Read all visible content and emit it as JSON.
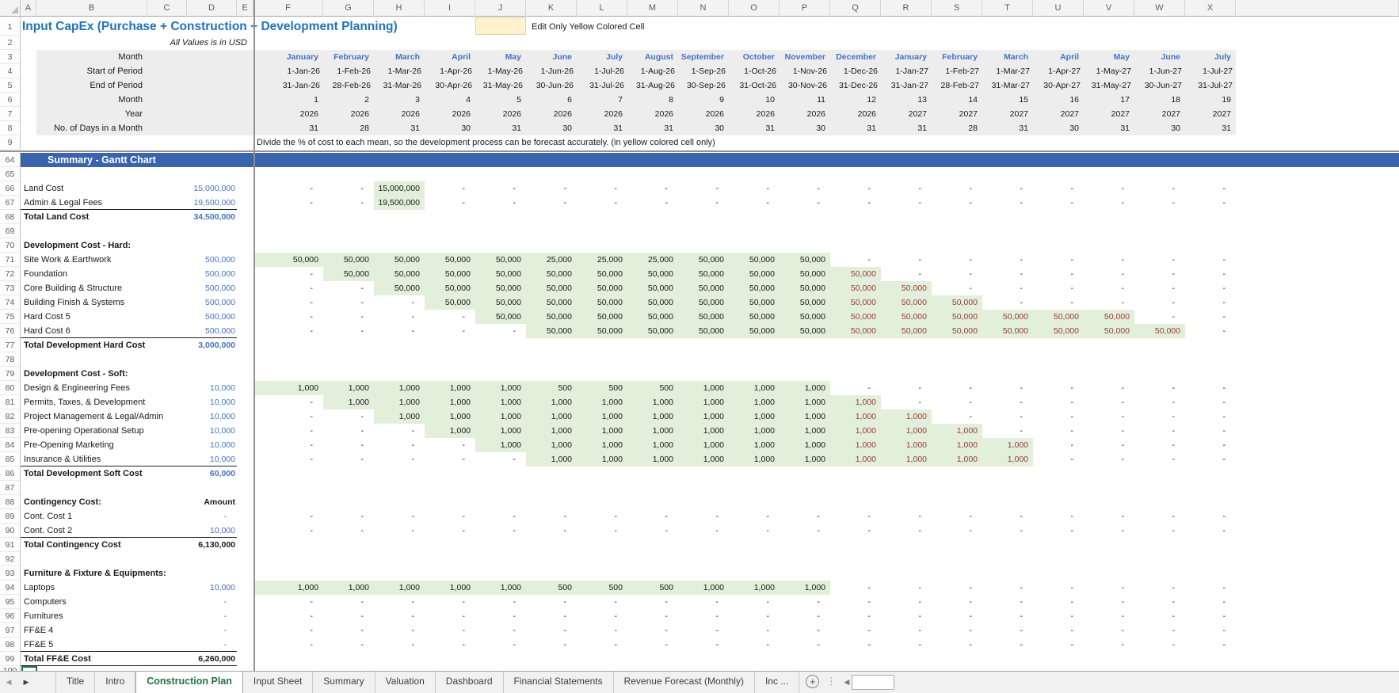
{
  "sheet": {
    "title": "Input CapEx (Purchase + Construction + Development Planning)",
    "subtitle": "All Values is in USD",
    "edit_note": "Edit Only Yellow Colored Cell",
    "hint": "Divide the % of cost to each mean, so the development process can be forecast accurately. (in yellow colored cell only)"
  },
  "colors": {
    "title_blue": "#2173BC",
    "value_blue": "#4472C4",
    "negative_red": "#9C3A38",
    "gantt_green_fill": "#E2EFDA",
    "band_blue": "#3A63AE",
    "active_tab_green": "#217346",
    "header_fill": "#EDEDED",
    "yellow_cell": "#FFF2CC"
  },
  "columns": {
    "letters": [
      "A",
      "B",
      "C",
      "D",
      "E",
      "F",
      "G",
      "H",
      "I",
      "J",
      "K",
      "L",
      "M",
      "N",
      "O",
      "P",
      "Q",
      "R",
      "S",
      "T",
      "U",
      "V",
      "W",
      "X"
    ]
  },
  "row_numbers_top": [
    "1",
    "2",
    "3",
    "4",
    "5",
    "6",
    "7",
    "8",
    "9"
  ],
  "frozen_labels": [
    "Month",
    "Start of Period",
    "End of Period",
    "Month",
    "Year",
    "No. of Days in a Month"
  ],
  "months": {
    "names": [
      "January",
      "February",
      "March",
      "April",
      "May",
      "June",
      "July",
      "August",
      "September",
      "October",
      "November",
      "December",
      "January",
      "February",
      "March",
      "April",
      "May",
      "June",
      "July"
    ],
    "start": [
      "1-Jan-26",
      "1-Feb-26",
      "1-Mar-26",
      "1-Apr-26",
      "1-May-26",
      "1-Jun-26",
      "1-Jul-26",
      "1-Aug-26",
      "1-Sep-26",
      "1-Oct-26",
      "1-Nov-26",
      "1-Dec-26",
      "1-Jan-27",
      "1-Feb-27",
      "1-Mar-27",
      "1-Apr-27",
      "1-May-27",
      "1-Jun-27",
      "1-Jul-27"
    ],
    "end": [
      "31-Jan-26",
      "28-Feb-26",
      "31-Mar-26",
      "30-Apr-26",
      "31-May-26",
      "30-Jun-26",
      "31-Jul-26",
      "31-Aug-26",
      "30-Sep-26",
      "31-Oct-26",
      "30-Nov-26",
      "31-Dec-26",
      "31-Jan-27",
      "28-Feb-27",
      "31-Mar-27",
      "30-Apr-27",
      "31-May-27",
      "30-Jun-27",
      "31-Jul-27"
    ],
    "index": [
      "1",
      "2",
      "3",
      "4",
      "5",
      "6",
      "7",
      "8",
      "9",
      "10",
      "11",
      "12",
      "13",
      "14",
      "15",
      "16",
      "17",
      "18",
      "19"
    ],
    "year": [
      "2026",
      "2026",
      "2026",
      "2026",
      "2026",
      "2026",
      "2026",
      "2026",
      "2026",
      "2026",
      "2026",
      "2026",
      "2027",
      "2027",
      "2027",
      "2027",
      "2027",
      "2027",
      "2027"
    ],
    "days": [
      "31",
      "28",
      "31",
      "30",
      "31",
      "30",
      "31",
      "31",
      "30",
      "31",
      "30",
      "31",
      "31",
      "28",
      "31",
      "30",
      "31",
      "30",
      "31"
    ]
  },
  "rows": [
    {
      "n": 64,
      "t": "band",
      "label": "Summary - Gantt Chart"
    },
    {
      "n": 65,
      "t": "empty"
    },
    {
      "n": 66,
      "t": "item",
      "label": "Land Cost",
      "amount": "15,000,000",
      "amt": "blue",
      "green": [
        2,
        2
      ],
      "vals": [
        "-",
        "-",
        "15,000,000",
        "-",
        "-",
        "-",
        "-",
        "-",
        "-",
        "-",
        "-",
        "-",
        "-",
        "-",
        "-",
        "-",
        "-",
        "-",
        "-"
      ]
    },
    {
      "n": 67,
      "t": "item",
      "label": "Admin & Legal Fees",
      "amount": "19,500,000",
      "amt": "blue",
      "ul": true,
      "green": [
        2,
        2
      ],
      "vals": [
        "-",
        "-",
        "19,500,000",
        "-",
        "-",
        "-",
        "-",
        "-",
        "-",
        "-",
        "-",
        "-",
        "-",
        "-",
        "-",
        "-",
        "-",
        "-",
        "-"
      ]
    },
    {
      "n": 68,
      "t": "total",
      "label": "Total Land Cost",
      "amount": "34,500,000",
      "amt": "blue-bold"
    },
    {
      "n": 69,
      "t": "empty"
    },
    {
      "n": 70,
      "t": "section",
      "label": "Development Cost - Hard:"
    },
    {
      "n": 71,
      "t": "item",
      "label": "Site Work & Earthwork",
      "amount": "500,000",
      "amt": "blue",
      "green": [
        0,
        10
      ],
      "vals": [
        "50,000",
        "50,000",
        "50,000",
        "50,000",
        "50,000",
        "25,000",
        "25,000",
        "25,000",
        "50,000",
        "50,000",
        "50,000",
        "-",
        "-",
        "-",
        "-",
        "-",
        "-",
        "-",
        "-"
      ]
    },
    {
      "n": 72,
      "t": "item",
      "label": "Foundation",
      "amount": "500,000",
      "amt": "blue",
      "green": [
        1,
        11
      ],
      "red": [
        11,
        11
      ],
      "vals": [
        "-",
        "50,000",
        "50,000",
        "50,000",
        "50,000",
        "50,000",
        "50,000",
        "50,000",
        "50,000",
        "50,000",
        "50,000",
        "50,000",
        "-",
        "-",
        "-",
        "-",
        "-",
        "-",
        "-"
      ]
    },
    {
      "n": 73,
      "t": "item",
      "label": "Core Building & Structure",
      "amount": "500,000",
      "amt": "blue",
      "green": [
        2,
        12
      ],
      "red": [
        11,
        12
      ],
      "vals": [
        "-",
        "-",
        "50,000",
        "50,000",
        "50,000",
        "50,000",
        "50,000",
        "50,000",
        "50,000",
        "50,000",
        "50,000",
        "50,000",
        "50,000",
        "-",
        "-",
        "-",
        "-",
        "-",
        "-"
      ]
    },
    {
      "n": 74,
      "t": "item",
      "label": "Building Finish & Systems",
      "amount": "500,000",
      "amt": "blue",
      "green": [
        3,
        13
      ],
      "red": [
        11,
        13
      ],
      "vals": [
        "-",
        "-",
        "-",
        "50,000",
        "50,000",
        "50,000",
        "50,000",
        "50,000",
        "50,000",
        "50,000",
        "50,000",
        "50,000",
        "50,000",
        "50,000",
        "-",
        "-",
        "-",
        "-",
        "-"
      ]
    },
    {
      "n": 75,
      "t": "item",
      "label": "Hard Cost 5",
      "amount": "500,000",
      "amt": "blue",
      "green": [
        4,
        16
      ],
      "red": [
        11,
        16
      ],
      "vals": [
        "-",
        "-",
        "-",
        "-",
        "50,000",
        "50,000",
        "50,000",
        "50,000",
        "50,000",
        "50,000",
        "50,000",
        "50,000",
        "50,000",
        "50,000",
        "50,000",
        "50,000",
        "50,000",
        "-",
        "-"
      ]
    },
    {
      "n": 76,
      "t": "item",
      "label": "Hard Cost 6",
      "amount": "500,000",
      "amt": "blue",
      "ul": true,
      "green": [
        5,
        17
      ],
      "red": [
        11,
        17
      ],
      "vals": [
        "-",
        "-",
        "-",
        "-",
        "-",
        "50,000",
        "50,000",
        "50,000",
        "50,000",
        "50,000",
        "50,000",
        "50,000",
        "50,000",
        "50,000",
        "50,000",
        "50,000",
        "50,000",
        "50,000",
        "-"
      ]
    },
    {
      "n": 77,
      "t": "total",
      "label": "Total Development Hard Cost",
      "amount": "3,000,000",
      "amt": "blue-bold"
    },
    {
      "n": 78,
      "t": "empty"
    },
    {
      "n": 79,
      "t": "section",
      "label": "Development Cost - Soft:"
    },
    {
      "n": 80,
      "t": "item",
      "label": "Design & Engineering Fees",
      "amount": "10,000",
      "amt": "blue",
      "green": [
        0,
        10
      ],
      "vals": [
        "1,000",
        "1,000",
        "1,000",
        "1,000",
        "1,000",
        "500",
        "500",
        "500",
        "1,000",
        "1,000",
        "1,000",
        "-",
        "-",
        "-",
        "-",
        "-",
        "-",
        "-",
        "-"
      ]
    },
    {
      "n": 81,
      "t": "item",
      "label": "Permits, Taxes, & Development",
      "amount": "10,000",
      "amt": "blue",
      "green": [
        1,
        11
      ],
      "red": [
        11,
        11
      ],
      "vals": [
        "-",
        "1,000",
        "1,000",
        "1,000",
        "1,000",
        "1,000",
        "1,000",
        "1,000",
        "1,000",
        "1,000",
        "1,000",
        "1,000",
        "-",
        "-",
        "-",
        "-",
        "-",
        "-",
        "-"
      ]
    },
    {
      "n": 82,
      "t": "item",
      "label": "Project Management & Legal/Admin",
      "amount": "10,000",
      "amt": "blue",
      "green": [
        2,
        12
      ],
      "red": [
        11,
        12
      ],
      "vals": [
        "-",
        "-",
        "1,000",
        "1,000",
        "1,000",
        "1,000",
        "1,000",
        "1,000",
        "1,000",
        "1,000",
        "1,000",
        "1,000",
        "1,000",
        "-",
        "-",
        "-",
        "-",
        "-",
        "-"
      ]
    },
    {
      "n": 83,
      "t": "item",
      "label": "Pre-opening Operational Setup",
      "amount": "10,000",
      "amt": "blue",
      "green": [
        3,
        13
      ],
      "red": [
        11,
        13
      ],
      "vals": [
        "-",
        "-",
        "-",
        "1,000",
        "1,000",
        "1,000",
        "1,000",
        "1,000",
        "1,000",
        "1,000",
        "1,000",
        "1,000",
        "1,000",
        "1,000",
        "-",
        "-",
        "-",
        "-",
        "-"
      ]
    },
    {
      "n": 84,
      "t": "item",
      "label": "Pre-Opening Marketing",
      "amount": "10,000",
      "amt": "blue",
      "green": [
        4,
        14
      ],
      "red": [
        11,
        14
      ],
      "vals": [
        "-",
        "-",
        "-",
        "-",
        "1,000",
        "1,000",
        "1,000",
        "1,000",
        "1,000",
        "1,000",
        "1,000",
        "1,000",
        "1,000",
        "1,000",
        "1,000",
        "-",
        "-",
        "-",
        "-"
      ]
    },
    {
      "n": 85,
      "t": "item",
      "label": "Insurance & Utilities",
      "amount": "10,000",
      "amt": "blue",
      "ul": true,
      "green": [
        5,
        14
      ],
      "red": [
        11,
        14
      ],
      "vals": [
        "-",
        "-",
        "-",
        "-",
        "-",
        "1,000",
        "1,000",
        "1,000",
        "1,000",
        "1,000",
        "1,000",
        "1,000",
        "1,000",
        "1,000",
        "1,000",
        "-",
        "-",
        "-",
        "-"
      ]
    },
    {
      "n": 86,
      "t": "total",
      "label": "Total Development Soft Cost",
      "amount": "60,000",
      "amt": "blue-bold"
    },
    {
      "n": 87,
      "t": "empty"
    },
    {
      "n": 88,
      "t": "section",
      "label": "Contingency Cost:",
      "amount": "Amount",
      "amt": "black-bold"
    },
    {
      "n": 89,
      "t": "item",
      "label": "Cont. Cost 1",
      "amount": "-",
      "amt": "blue",
      "vals": [
        "-",
        "-",
        "-",
        "-",
        "-",
        "-",
        "-",
        "-",
        "-",
        "-",
        "-",
        "-",
        "-",
        "-",
        "-",
        "-",
        "-",
        "-",
        "-"
      ]
    },
    {
      "n": 90,
      "t": "item",
      "label": "Cont. Cost 2",
      "amount": "10,000",
      "amt": "blue",
      "ul": true,
      "vals": [
        "-",
        "-",
        "-",
        "-",
        "-",
        "-",
        "-",
        "-",
        "-",
        "-",
        "-",
        "-",
        "-",
        "-",
        "-",
        "-",
        "-",
        "-",
        "-"
      ]
    },
    {
      "n": 91,
      "t": "total",
      "label": "Total Contingency Cost",
      "amount": "6,130,000",
      "amt": "black-bold"
    },
    {
      "n": 92,
      "t": "empty"
    },
    {
      "n": 93,
      "t": "section",
      "label": "Furniture & Fixture & Equipments:"
    },
    {
      "n": 94,
      "t": "item",
      "label": "Laptops",
      "amount": "10,000",
      "amt": "blue",
      "green": [
        0,
        10
      ],
      "vals": [
        "1,000",
        "1,000",
        "1,000",
        "1,000",
        "1,000",
        "500",
        "500",
        "500",
        "1,000",
        "1,000",
        "1,000",
        "-",
        "-",
        "-",
        "-",
        "-",
        "-",
        "-",
        "-"
      ]
    },
    {
      "n": 95,
      "t": "item",
      "label": "Computers",
      "amount": "-",
      "amt": "blue",
      "vals": [
        "-",
        "-",
        "-",
        "-",
        "-",
        "-",
        "-",
        "-",
        "-",
        "-",
        "-",
        "-",
        "-",
        "-",
        "-",
        "-",
        "-",
        "-",
        "-"
      ]
    },
    {
      "n": 96,
      "t": "item",
      "label": "Furnitures",
      "amount": "-",
      "amt": "blue",
      "vals": [
        "-",
        "-",
        "-",
        "-",
        "-",
        "-",
        "-",
        "-",
        "-",
        "-",
        "-",
        "-",
        "-",
        "-",
        "-",
        "-",
        "-",
        "-",
        "-"
      ]
    },
    {
      "n": 97,
      "t": "item",
      "label": "FF&E 4",
      "amount": "-",
      "amt": "blue",
      "vals": [
        "-",
        "-",
        "-",
        "-",
        "-",
        "-",
        "-",
        "-",
        "-",
        "-",
        "-",
        "-",
        "-",
        "-",
        "-",
        "-",
        "-",
        "-",
        "-"
      ]
    },
    {
      "n": 98,
      "t": "item",
      "label": "FF&E 5",
      "amount": "-",
      "amt": "blue",
      "ul": true,
      "vals": [
        "-",
        "-",
        "-",
        "-",
        "-",
        "-",
        "-",
        "-",
        "-",
        "-",
        "-",
        "-",
        "-",
        "-",
        "-",
        "-",
        "-",
        "-",
        "-"
      ]
    },
    {
      "n": 99,
      "t": "total",
      "label": "Total FF&E Cost",
      "amount": "6,260,000",
      "amt": "black-bold",
      "ul": true
    }
  ],
  "partial_row": {
    "number": "100"
  },
  "tabs": {
    "items": [
      {
        "label": "Title"
      },
      {
        "label": "Intro"
      },
      {
        "label": "Construction Plan",
        "active": true
      },
      {
        "label": "Input Sheet"
      },
      {
        "label": "Summary"
      },
      {
        "label": "Valuation"
      },
      {
        "label": "Dashboard"
      },
      {
        "label": "Financial Statements"
      },
      {
        "label": "Revenue Forecast (Monthly)"
      },
      {
        "label": "Inc ..."
      }
    ],
    "new_sheet_label": "+"
  }
}
